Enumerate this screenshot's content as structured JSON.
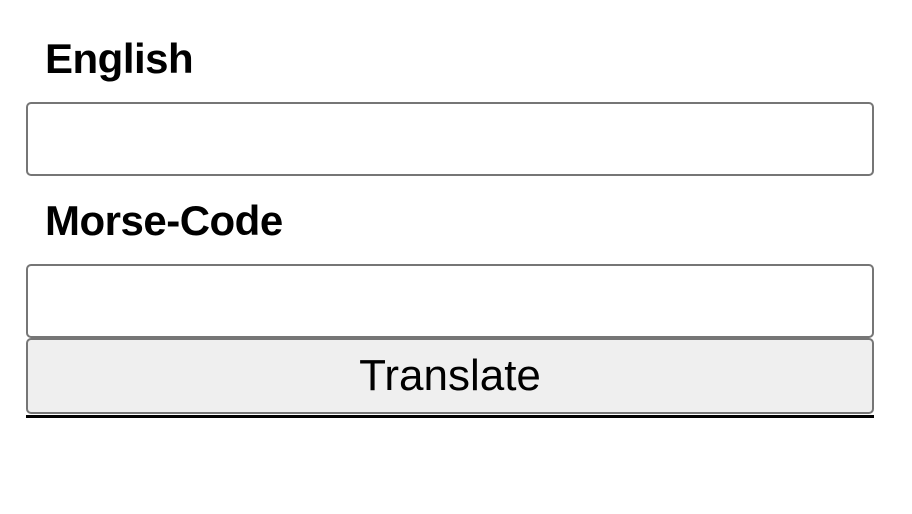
{
  "english": {
    "label": "English",
    "value": "",
    "placeholder": ""
  },
  "morse": {
    "label": "Morse-Code",
    "value": "",
    "placeholder": ""
  },
  "translate_button": {
    "label": "Translate"
  }
}
